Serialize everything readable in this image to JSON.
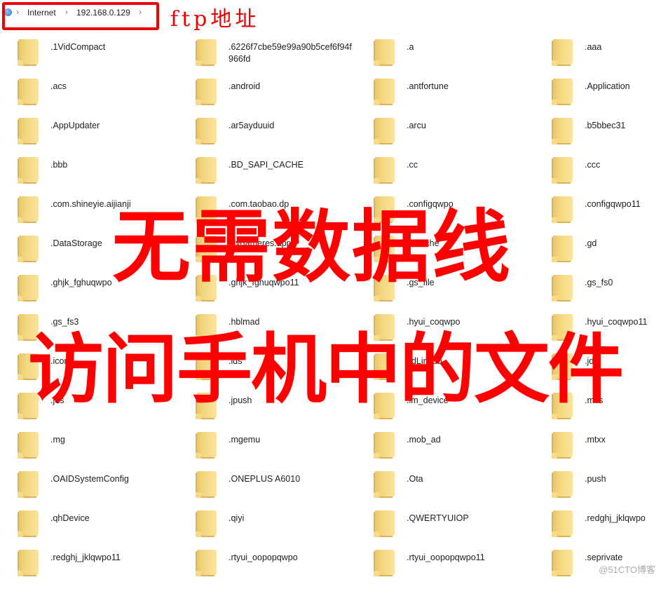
{
  "breadcrumb": {
    "items": [
      "Internet",
      "192.168.0.129"
    ],
    "icon": "network-globe-icon"
  },
  "annotations": {
    "ftp_label": "ftp地址",
    "line1": "无需数据线",
    "line2": "访问手机中的文件",
    "color": "#ff0000"
  },
  "watermark": "@51CTO博客",
  "folders": [
    ".1VidCompact",
    ".6226f7cbe59e99a90b5cef6f94f966fd",
    ".a",
    ".aaa",
    ".acs",
    ".android",
    ".antfortune",
    ".Application",
    ".AppUpdater",
    ".ar5ayduuid",
    ".arcu",
    ".b5bbec31",
    ".bbb",
    ".BD_SAPI_CACHE",
    ".cc",
    ".ccc",
    ".com.shineyie.aijianji",
    ".com.taobao.dp",
    ".configqwpo",
    ".configqwpo11",
    ".DataStorage",
    ".dygameres.apps",
    ".fccache",
    ".gd",
    ".ghjk_fghuqwpo",
    ".ghjk_fghuqwpo11",
    ".gs_file",
    ".gs_fs0",
    ".gs_fs3",
    ".hblmad",
    ".hyui_coqwpo",
    ".hyui_coqwpo11",
    ".icon",
    ".ids",
    ".IdLinkdo",
    ".jdd",
    ".jds",
    ".jpush",
    ".lm_device",
    ".mcs",
    ".mg",
    ".mgemu",
    ".mob_ad",
    ".mtxx",
    ".OAIDSystemConfig",
    ".ONEPLUS A6010",
    ".Ota",
    ".push",
    ".qhDevice",
    ".qiyi",
    ".QWERTYUIOP",
    ".redghj_jklqwpo",
    ".redghj_jklqwpo11",
    ".rtyui_oopopqwpo",
    ".rtyui_oopopqwpo11",
    ".seprivate"
  ]
}
